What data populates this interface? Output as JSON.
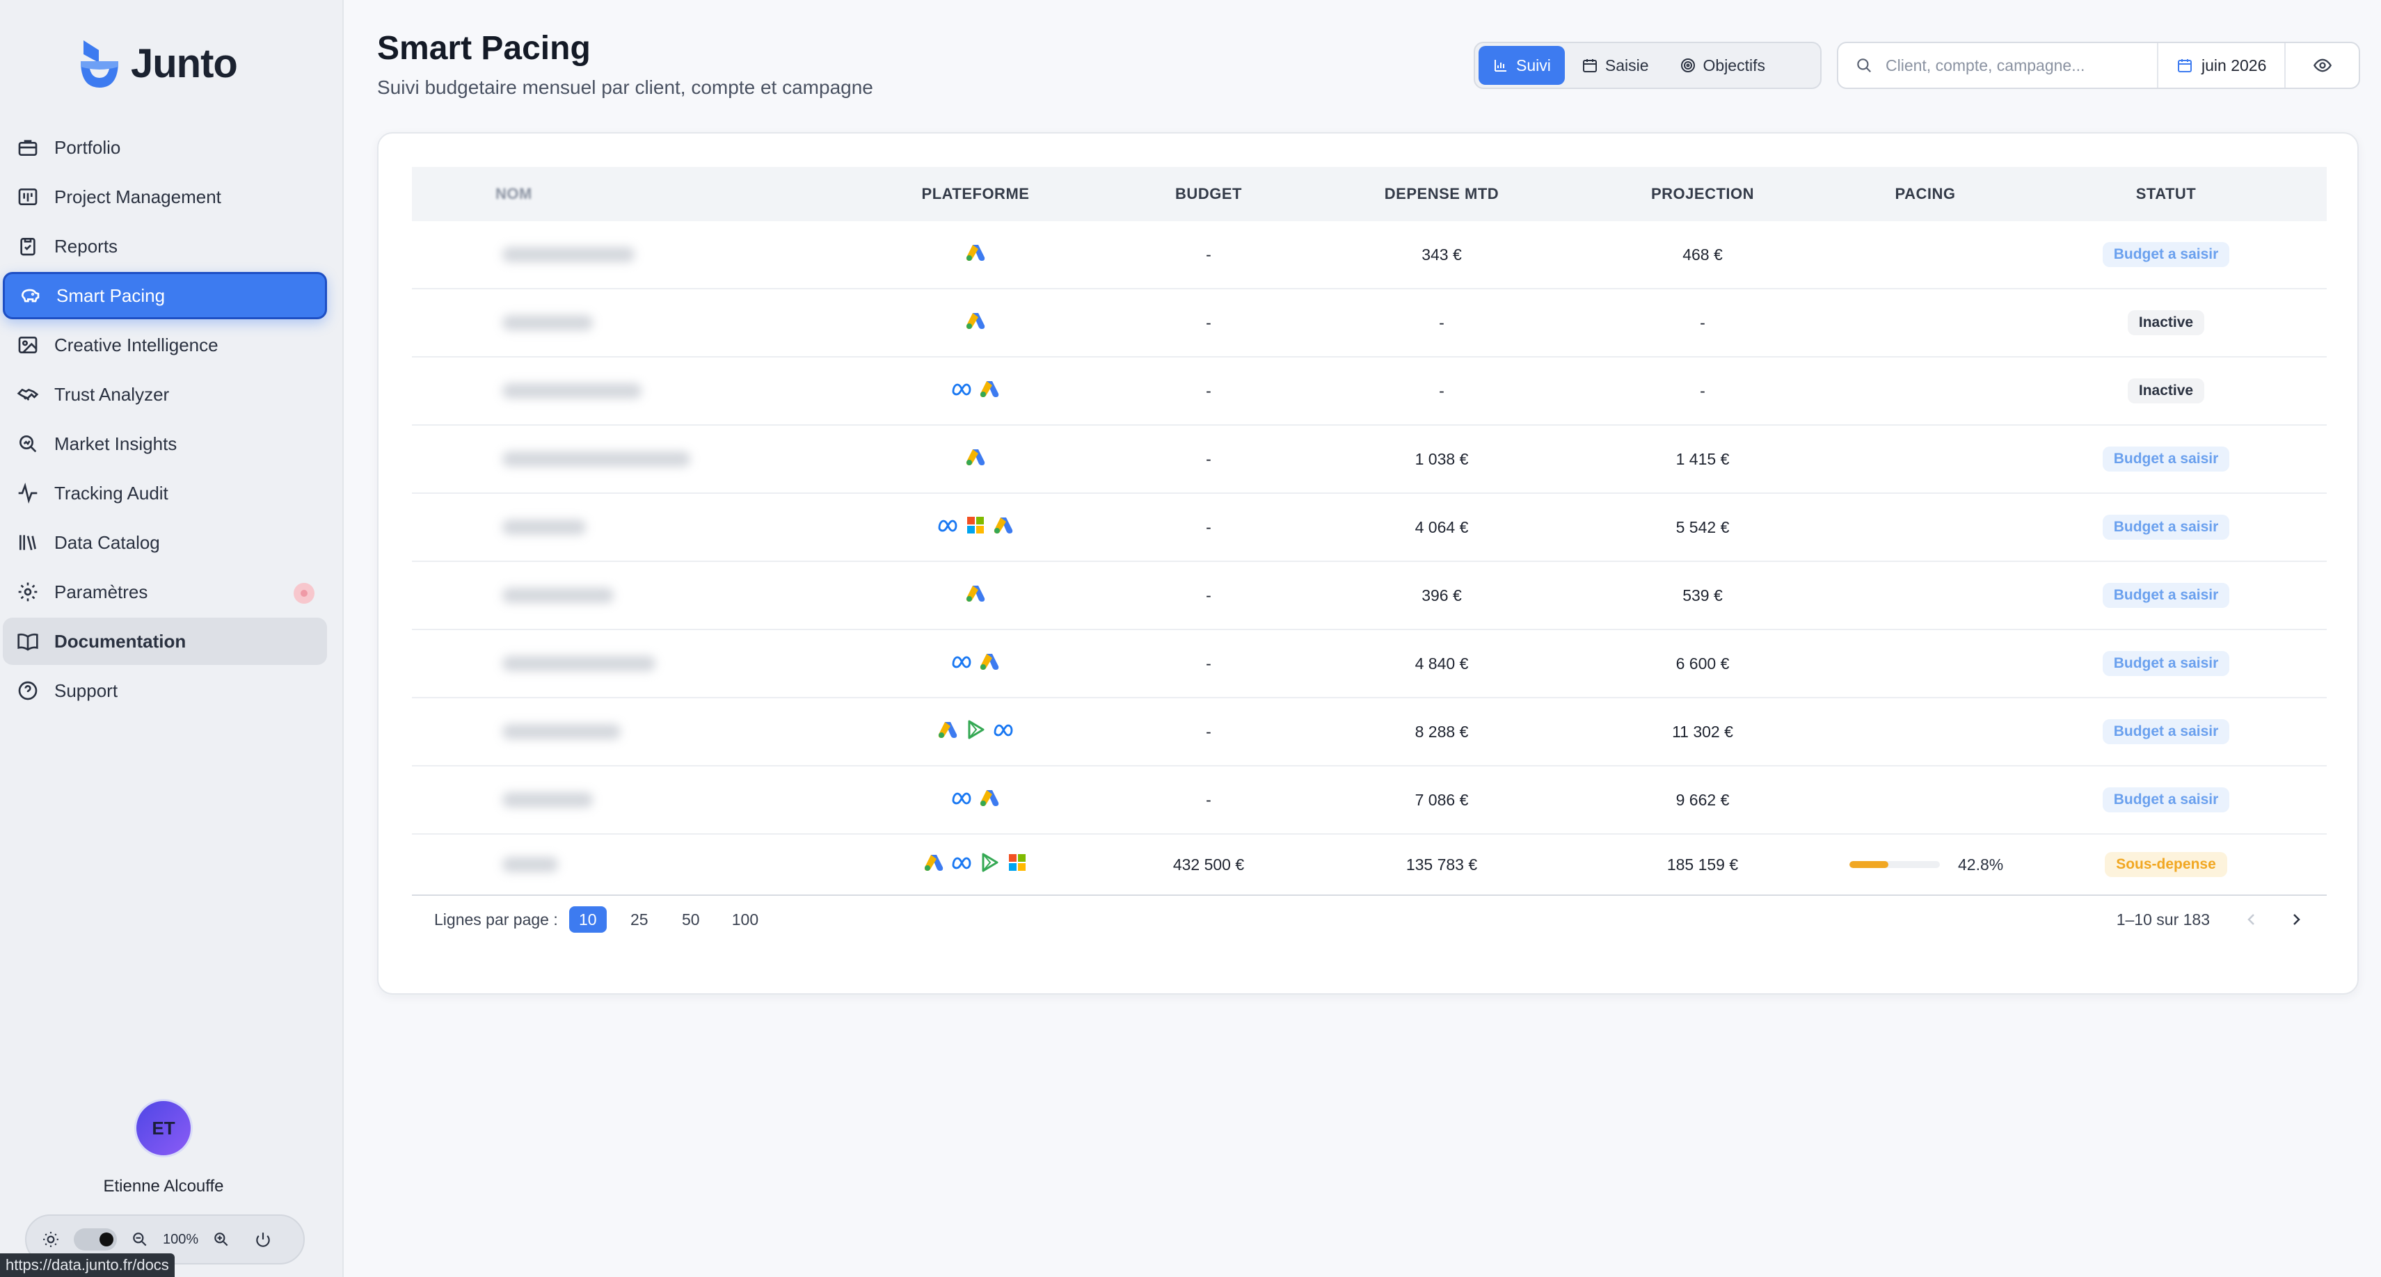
{
  "app": {
    "name": "Junto"
  },
  "sidebar": {
    "items": [
      {
        "label": "Portfolio",
        "icon": "briefcase-icon"
      },
      {
        "label": "Project Management",
        "icon": "kanban-icon"
      },
      {
        "label": "Reports",
        "icon": "clipboard-icon"
      },
      {
        "label": "Smart Pacing",
        "icon": "piggy-bank-icon"
      },
      {
        "label": "Creative Intelligence",
        "icon": "image-icon"
      },
      {
        "label": "Trust Analyzer",
        "icon": "handshake-icon"
      },
      {
        "label": "Market Insights",
        "icon": "search-chart-icon"
      },
      {
        "label": "Tracking Audit",
        "icon": "activity-icon"
      },
      {
        "label": "Data Catalog",
        "icon": "library-icon"
      },
      {
        "label": "Paramètres",
        "icon": "gear-icon"
      },
      {
        "label": "Documentation",
        "icon": "book-icon"
      },
      {
        "label": "Support",
        "icon": "help-circle-icon"
      }
    ],
    "active_index": 3,
    "hover_index": 10,
    "user": {
      "initials": "ET",
      "name": "Etienne Alcouffe"
    },
    "zoom_label": "100%",
    "status_url": "https://data.junto.fr/docs"
  },
  "header": {
    "title": "Smart Pacing",
    "subtitle": "Suivi budgetaire mensuel par client, compte et campagne",
    "tabs": [
      {
        "label": "Suivi",
        "icon": "bar-chart-icon"
      },
      {
        "label": "Saisie",
        "icon": "calendar-icon"
      },
      {
        "label": "Objectifs",
        "icon": "target-icon"
      }
    ],
    "active_tab": 0,
    "search_placeholder": "Client, compte, campagne...",
    "month_label": "juin 2026"
  },
  "table": {
    "columns": {
      "nom": "NOM",
      "plateforme": "PLATEFORME",
      "budget": "BUDGET",
      "depense": "DEPENSE MTD",
      "projection": "PROJECTION",
      "pacing": "PACING",
      "statut": "STATUT"
    },
    "rows": [
      {
        "platforms": [
          "google-ads"
        ],
        "budget": "-",
        "depense": "343 €",
        "projection": "468 €",
        "pacing": null,
        "pacing_pct": "",
        "statut": "Budget a saisir",
        "statut_kind": "saisir"
      },
      {
        "platforms": [
          "google-ads"
        ],
        "budget": "-",
        "depense": "-",
        "projection": "-",
        "pacing": null,
        "pacing_pct": "",
        "statut": "Inactive",
        "statut_kind": "inactive"
      },
      {
        "platforms": [
          "meta",
          "google-ads"
        ],
        "budget": "-",
        "depense": "-",
        "projection": "-",
        "pacing": null,
        "pacing_pct": "",
        "statut": "Inactive",
        "statut_kind": "inactive"
      },
      {
        "platforms": [
          "google-ads"
        ],
        "budget": "-",
        "depense": "1 038 €",
        "projection": "1 415 €",
        "pacing": null,
        "pacing_pct": "",
        "statut": "Budget a saisir",
        "statut_kind": "saisir"
      },
      {
        "platforms": [
          "meta",
          "microsoft",
          "google-ads"
        ],
        "budget": "-",
        "depense": "4 064 €",
        "projection": "5 542 €",
        "pacing": null,
        "pacing_pct": "",
        "statut": "Budget a saisir",
        "statut_kind": "saisir"
      },
      {
        "platforms": [
          "google-ads"
        ],
        "budget": "-",
        "depense": "396 €",
        "projection": "539 €",
        "pacing": null,
        "pacing_pct": "",
        "statut": "Budget a saisir",
        "statut_kind": "saisir"
      },
      {
        "platforms": [
          "meta",
          "google-ads"
        ],
        "budget": "-",
        "depense": "4 840 €",
        "projection": "6 600 €",
        "pacing": null,
        "pacing_pct": "",
        "statut": "Budget a saisir",
        "statut_kind": "saisir"
      },
      {
        "platforms": [
          "google-ads",
          "play",
          "meta"
        ],
        "budget": "-",
        "depense": "8 288 €",
        "projection": "11 302 €",
        "pacing": null,
        "pacing_pct": "",
        "statut": "Budget a saisir",
        "statut_kind": "saisir"
      },
      {
        "platforms": [
          "meta",
          "google-ads"
        ],
        "budget": "-",
        "depense": "7 086 €",
        "projection": "9 662 €",
        "pacing": null,
        "pacing_pct": "",
        "statut": "Budget a saisir",
        "statut_kind": "saisir"
      },
      {
        "platforms": [
          "google-ads",
          "meta",
          "play",
          "microsoft"
        ],
        "budget": "432 500 €",
        "depense": "135 783 €",
        "projection": "185 159 €",
        "pacing": 0.428,
        "pacing_pct": "42.8%",
        "statut": "Sous-depense",
        "statut_kind": "sous"
      }
    ]
  },
  "pagination": {
    "label": "Lignes par page :",
    "sizes": [
      "10",
      "25",
      "50",
      "100"
    ],
    "active_size": 0,
    "range": "1–10 sur 183"
  },
  "colors": {
    "accent": "#3d7bf0",
    "status_saisir": "#6aa0ee",
    "status_sous": "#f1a722"
  }
}
